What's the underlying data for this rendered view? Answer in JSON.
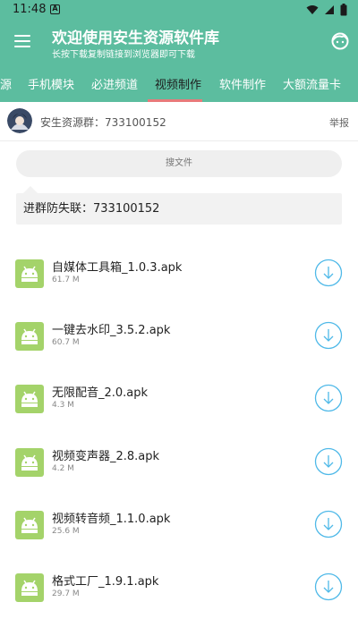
{
  "status_bar": {
    "time": "11:48",
    "notification_letter": "A",
    "icons": [
      "wifi-icon",
      "signal-icon",
      "battery-icon"
    ]
  },
  "app_bar": {
    "title": "欢迎使用安生资源软件库",
    "subtitle": "长按下载复制链接到浏览器即可下载",
    "color": "#5cbd9f"
  },
  "tabs": {
    "items": [
      {
        "label": "源"
      },
      {
        "label": "手机模块"
      },
      {
        "label": "必进频道"
      },
      {
        "label": "视频制作",
        "active": true
      },
      {
        "label": "软件制作"
      },
      {
        "label": "大额流量卡"
      }
    ],
    "indicator_color": "#e87a7a"
  },
  "group_row": {
    "text": "安生资源群：733100152",
    "report_label": "举报"
  },
  "search": {
    "placeholder": "搜文件"
  },
  "notice": {
    "text": "进群防失联：733100152"
  },
  "files": [
    {
      "name": "自媒体工具箱_1.0.3.apk",
      "size": "61.7 M"
    },
    {
      "name": "一键去水印_3.5.2.apk",
      "size": "60.7 M"
    },
    {
      "name": "无限配音_2.0.apk",
      "size": "4.3 M"
    },
    {
      "name": "视频变声器_2.8.apk",
      "size": "4.2 M"
    },
    {
      "name": "视频转音频_1.1.0.apk",
      "size": "25.6 M"
    },
    {
      "name": "格式工厂_1.9.1.apk",
      "size": "29.7 M"
    }
  ],
  "colors": {
    "accent": "#5cbd9f",
    "android_icon": "#a4d36a",
    "download_button": "#4fb9e8"
  }
}
